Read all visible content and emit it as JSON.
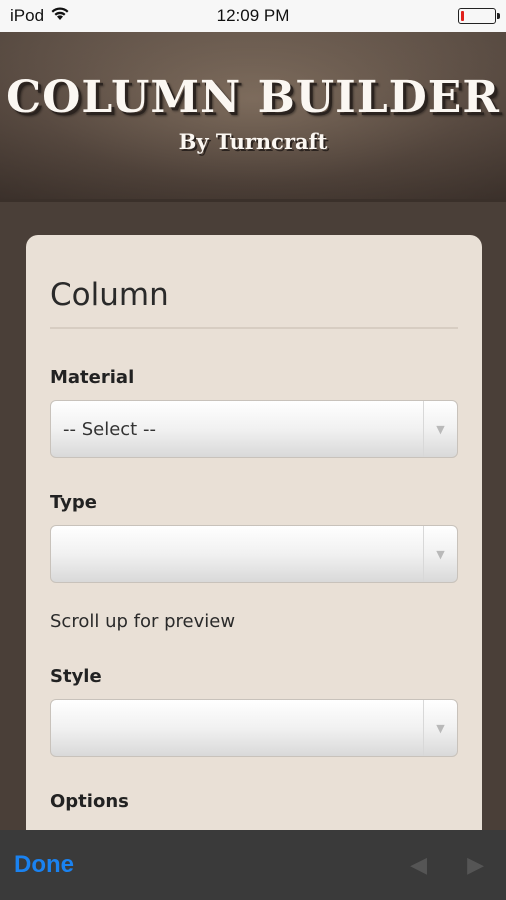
{
  "status_bar": {
    "carrier": "iPod",
    "time": "12:09 PM",
    "battery_level": 0.1,
    "battery_color": "#e0201b"
  },
  "header": {
    "title": "COLUMN BUILDER",
    "subtitle": "By Turncraft"
  },
  "form": {
    "title": "Column",
    "material": {
      "label": "Material",
      "value": "-- Select --"
    },
    "type": {
      "label": "Type",
      "value": ""
    },
    "hint": "Scroll up for preview",
    "style": {
      "label": "Style",
      "value": ""
    },
    "options": {
      "label": "Options"
    }
  },
  "toolbar": {
    "done_label": "Done",
    "prev_icon": "left-arrow-icon",
    "next_icon": "right-arrow-icon",
    "accent_color": "#1a82f0"
  }
}
